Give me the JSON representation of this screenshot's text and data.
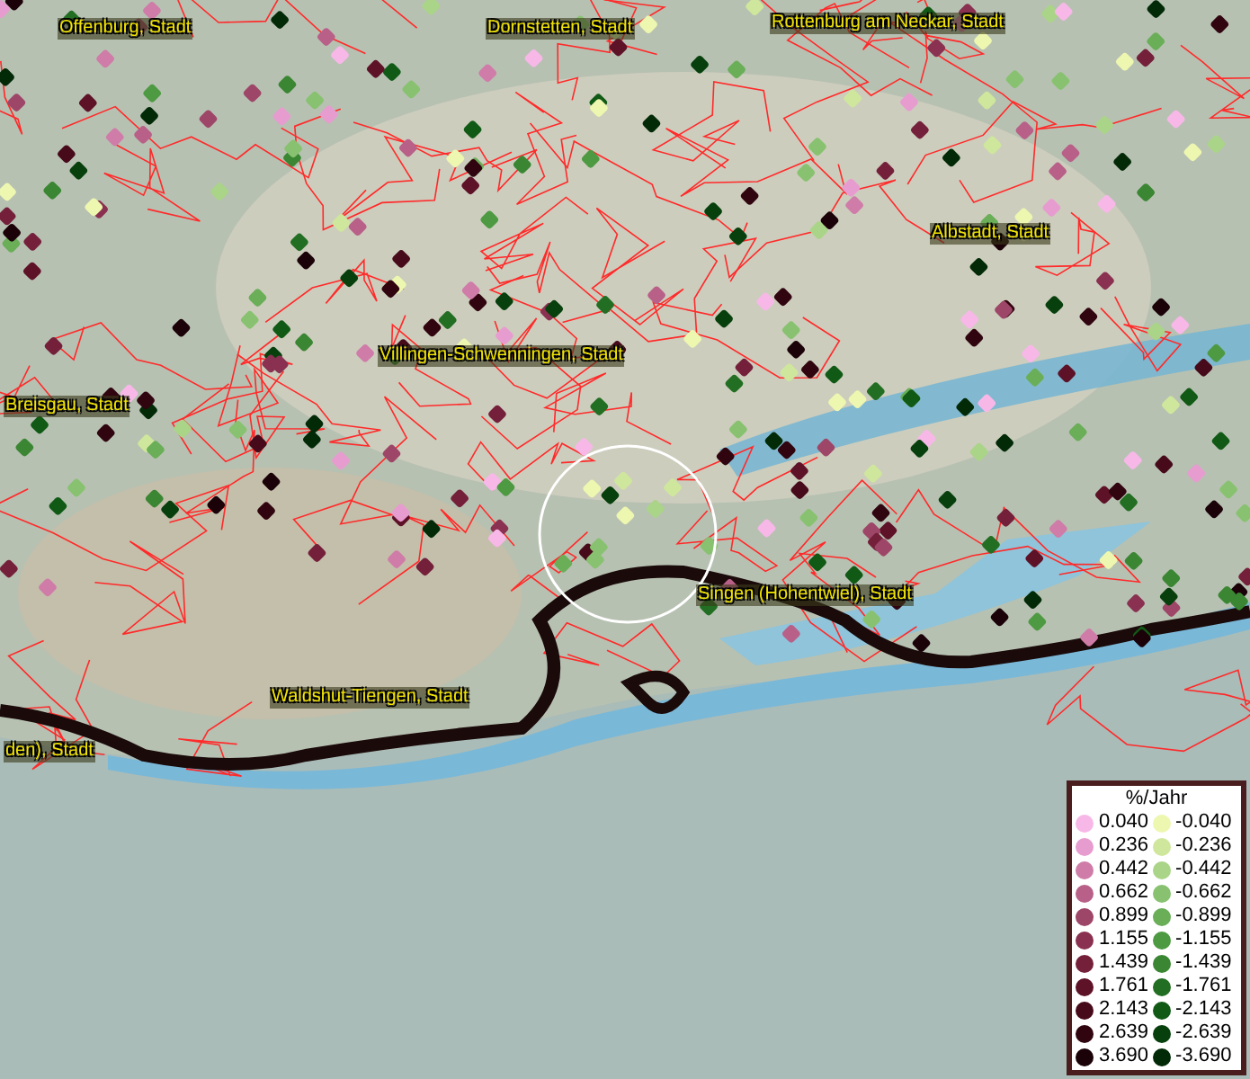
{
  "map": {
    "labels": [
      {
        "text": "Offenburg, Stadt"
      },
      {
        "text": "Dornstetten, Stadt"
      },
      {
        "text": "Rottenburg am Neckar, Stadt"
      },
      {
        "text": "Albstadt, Stadt"
      },
      {
        "text": "Villingen-Schwenningen, Stadt"
      },
      {
        "text": "Breisgau, Stadt"
      },
      {
        "text": "Singen (Hohentwiel), Stadt"
      },
      {
        "text": "Waldshut-Tiengen, Stadt"
      },
      {
        "text": "den), Stadt"
      }
    ]
  },
  "legend": {
    "title": "%/Jahr",
    "columns": [
      {
        "items": [
          {
            "value": "0.040",
            "color": "#f7b8e8"
          },
          {
            "value": "0.236",
            "color": "#e79ccf"
          },
          {
            "value": "0.442",
            "color": "#cf7ca8"
          },
          {
            "value": "0.662",
            "color": "#b86088"
          },
          {
            "value": "0.899",
            "color": "#9e4668"
          },
          {
            "value": "1.155",
            "color": "#8a3050"
          },
          {
            "value": "1.439",
            "color": "#74203a"
          },
          {
            "value": "1.761",
            "color": "#5e1228"
          },
          {
            "value": "2.143",
            "color": "#460a1a"
          },
          {
            "value": "2.639",
            "color": "#30050f"
          },
          {
            "value": "3.690",
            "color": "#1a0208"
          }
        ]
      },
      {
        "items": [
          {
            "value": "-0.040",
            "color": "#eef7b0"
          },
          {
            "value": "-0.236",
            "color": "#cfe79c"
          },
          {
            "value": "-0.442",
            "color": "#aad488"
          },
          {
            "value": "-0.662",
            "color": "#88c270"
          },
          {
            "value": "-0.899",
            "color": "#6aae58"
          },
          {
            "value": "-1.155",
            "color": "#4e9a42"
          },
          {
            "value": "-1.439",
            "color": "#3a8632"
          },
          {
            "value": "-1.761",
            "color": "#226e22"
          },
          {
            "value": "-2.143",
            "color": "#115a16"
          },
          {
            "value": "-2.639",
            "color": "#07400c"
          },
          {
            "value": "-3.690",
            "color": "#022a06"
          }
        ]
      }
    ]
  }
}
